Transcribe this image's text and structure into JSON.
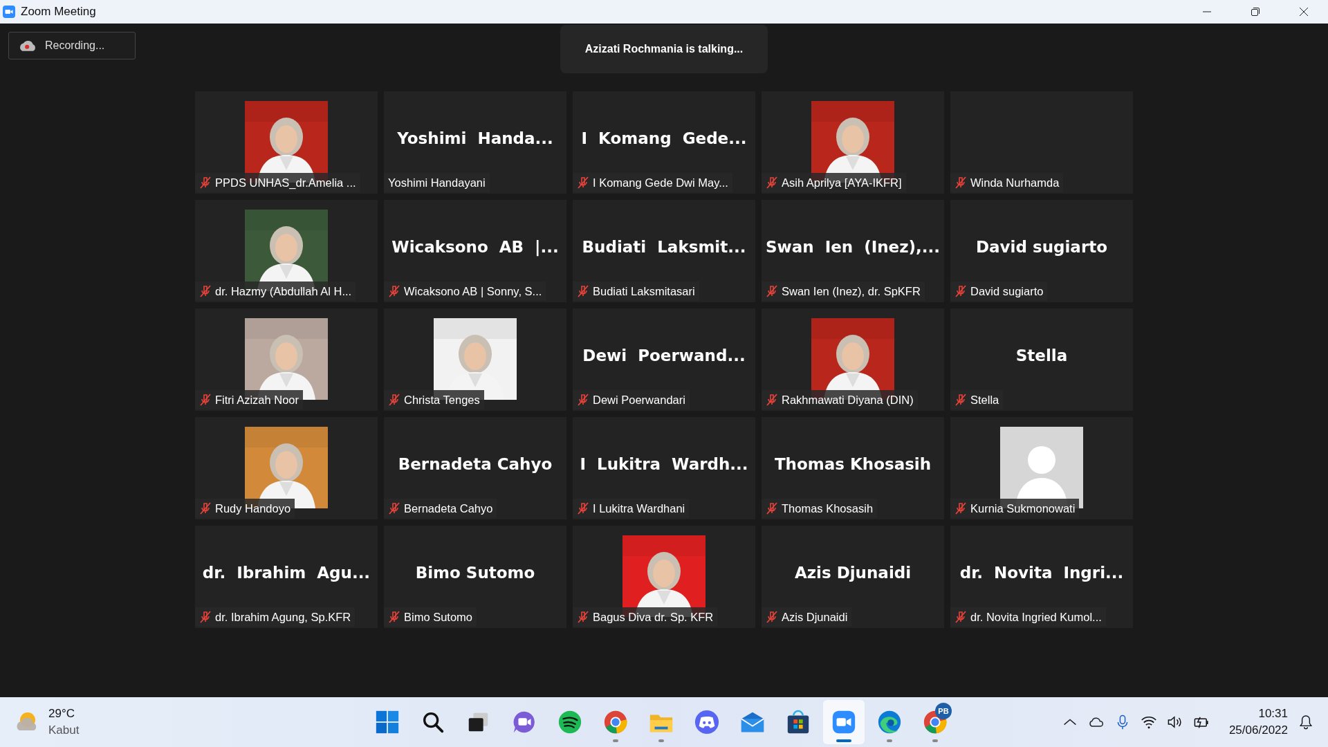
{
  "window": {
    "title": "Zoom Meeting"
  },
  "recording": {
    "label": "Recording..."
  },
  "speaker_banner": {
    "text": "Azizati Rochmania is talking..."
  },
  "participants": [
    {
      "label": "PPDS UNHAS_dr.Amelia ...",
      "muted": true
    },
    {
      "kind": "name",
      "display_name": "Yoshimi  Handa...",
      "label": "Yoshimi Handayani",
      "muted": false
    },
    {
      "kind": "name",
      "display_name": "I  Komang  Gede...",
      "label": "I Komang Gede Dwi May...",
      "muted": true
    },
    {
      "label": "Asih Aprilya [AYA-IKFR]",
      "muted": true
    },
    {
      "kind": "blank",
      "label": "Winda Nurhamda",
      "muted": true
    },
    {
      "label": "dr. Hazmy (Abdullah Al H...",
      "muted": true
    },
    {
      "kind": "name",
      "display_name": "Wicaksono  AB  |...",
      "label": "Wicaksono AB | Sonny, S...",
      "muted": true
    },
    {
      "kind": "name",
      "display_name": "Budiati  Laksmit...",
      "label": "Budiati Laksmitasari",
      "muted": true
    },
    {
      "kind": "name",
      "display_name": "Swan  Ien  (Inez),...",
      "label": "Swan Ien (Inez), dr. SpKFR",
      "muted": true
    },
    {
      "kind": "name",
      "display_name": "David sugiarto",
      "label": "David sugiarto",
      "muted": true
    },
    {
      "label": "Fitri Azizah Noor",
      "muted": true
    },
    {
      "label": "Christa Tenges",
      "muted": true
    },
    {
      "kind": "name",
      "display_name": "Dewi  Poerwand...",
      "label": "Dewi Poerwandari",
      "muted": true
    },
    {
      "label": "Rakhmawati Diyana (DIN)",
      "muted": true
    },
    {
      "kind": "name",
      "display_name": "Stella",
      "label": "Stella",
      "muted": true
    },
    {
      "label": "Rudy Handoyo",
      "muted": true
    },
    {
      "kind": "name",
      "display_name": "Bernadeta Cahyo",
      "label": "Bernadeta Cahyo",
      "muted": true
    },
    {
      "kind": "name",
      "display_name": "I  Lukitra  Wardh...",
      "label": "I Lukitra Wardhani",
      "muted": true
    },
    {
      "kind": "name",
      "display_name": "Thomas Khosasih",
      "label": "Thomas Khosasih",
      "muted": true
    },
    {
      "kind": "avatar",
      "label": "Kurnia Sukmonowati",
      "muted": true
    },
    {
      "kind": "name",
      "display_name": "dr.  Ibrahim  Agu...",
      "label": "dr. Ibrahim Agung, Sp.KFR",
      "muted": true
    },
    {
      "kind": "name",
      "display_name": "Bimo Sutomo",
      "label": "Bimo Sutomo",
      "muted": true
    },
    {
      "label": "Bagus Diva dr. Sp. KFR",
      "muted": true
    },
    {
      "kind": "name",
      "display_name": "Azis Djunaidi",
      "label": "Azis Djunaidi",
      "muted": true
    },
    {
      "kind": "name",
      "display_name": "dr.  Novita  Ingri...",
      "label": "dr. Novita Ingried Kumol...",
      "muted": true
    }
  ],
  "taskbar": {
    "weather": {
      "temperature": "29°C",
      "condition": "Kabut"
    },
    "apps": [
      {
        "kind": "start",
        "running": false,
        "active": false
      },
      {
        "kind": "search",
        "running": false,
        "active": false
      },
      {
        "kind": "taskview",
        "running": false,
        "active": false
      },
      {
        "kind": "chat",
        "running": false,
        "active": false
      },
      {
        "kind": "music",
        "running": false,
        "active": false
      },
      {
        "kind": "browser",
        "running": true,
        "active": false
      },
      {
        "kind": "folder",
        "running": true,
        "active": false
      },
      {
        "kind": "gamepad",
        "running": false,
        "active": false
      },
      {
        "kind": "mail",
        "running": false,
        "active": false
      },
      {
        "kind": "store",
        "running": false,
        "active": false
      },
      {
        "kind": "camera",
        "running": true,
        "active": true
      },
      {
        "kind": "edge",
        "running": true,
        "active": false
      },
      {
        "kind": "browser",
        "running": true,
        "active": false,
        "badge": "PB"
      }
    ],
    "clock": {
      "time": "10:31",
      "date": "25/06/2022"
    }
  }
}
